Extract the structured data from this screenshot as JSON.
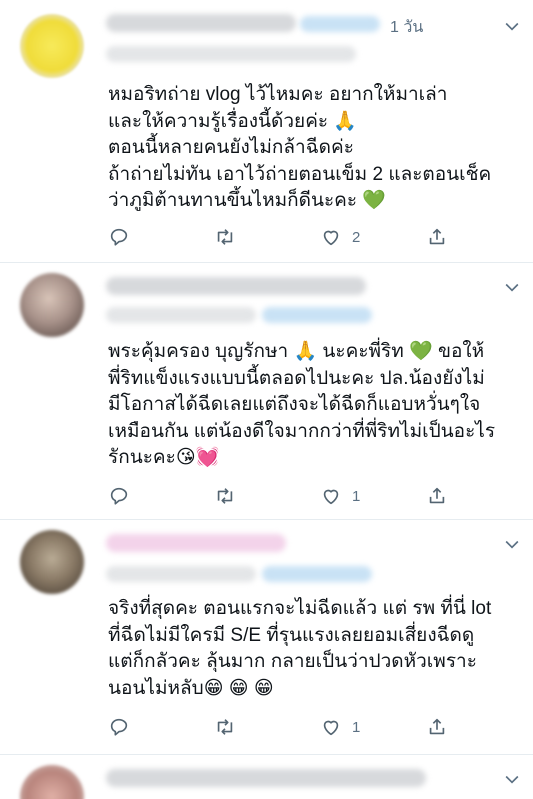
{
  "tweets": [
    {
      "time": "1 วัน",
      "text": "หมอริทถ่าย vlog ไว้ไหมคะ อยากให้มาเล่า\nและให้ความรู้เรื่องนี้ด้วยค่ะ 🙏\nตอนนี้หลายคนยังไม่กล้าฉีดค่ะ\nถ้าถ่ายไม่ทัน เอาไว้ถ่ายตอนเข็ม 2 และตอนเช็ค\nว่าภูมิต้านทานขึ้นไหมก็ดีนะคะ 💚",
      "like_count": "2",
      "avatar_color": "#f2e24a"
    },
    {
      "time": "",
      "text": "พระคุ้มครอง บุญรักษา 🙏 นะคะพี่ริท 💚 ขอให้\nพี่ริทแข็งแรงแบบนี้ตลอดไปนะคะ  ปล.น้องยังไม่\nมีโอกาสได้ฉีดเลยแต่ถึงจะได้ฉีดก็แอบหวั่นๆใจ\nเหมือนกัน แต่น้องดีใจมากกว่าที่พี่ริทไม่เป็นอะไร\nรักนะคะ😘💓",
      "like_count": "1",
      "avatar_color": "#b7a39a"
    },
    {
      "time": "",
      "text": "จริงที่สุดคะ  ตอนแรกจะไม่ฉีดแล้ว แต่ รพ ที่นี่ lot\nที่ฉีดไม่มีใครมี  S/E ที่รุนแรงเลยยอมเสี่ยงฉีดดู\nแต่ก็กลัวคะ  ลุ้นมาก  กลายเป็นว่าปวดหัวเพราะ\nนอนไม่หลับ😁 😁 😁",
      "like_count": "1",
      "avatar_color": "#8c7b68"
    }
  ],
  "icons": [
    "reply-icon",
    "retweet-icon",
    "like-icon",
    "share-icon",
    "chevron-down-icon"
  ]
}
